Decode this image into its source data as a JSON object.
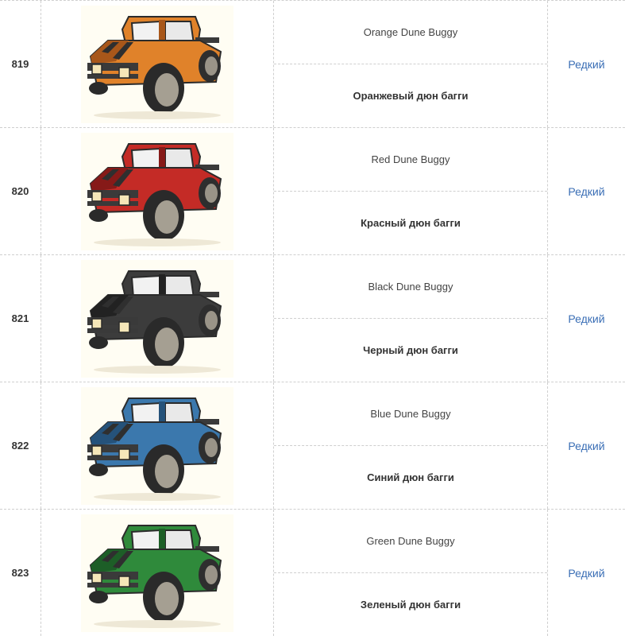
{
  "rows": [
    {
      "id": "819",
      "name_en": "Orange Dune Buggy",
      "name_ru": "Оранжевый дюн багги",
      "rarity": "Редкий",
      "color": "#e0822a",
      "color_dark": "#a8571a",
      "icon": "orange-dune-buggy-icon"
    },
    {
      "id": "820",
      "name_en": "Red Dune Buggy",
      "name_ru": "Красный дюн багги",
      "rarity": "Редкий",
      "color": "#c42b26",
      "color_dark": "#861a18",
      "icon": "red-dune-buggy-icon"
    },
    {
      "id": "821",
      "name_en": "Black Dune Buggy",
      "name_ru": "Черный дюн багги",
      "rarity": "Редкий",
      "color": "#3c3c3c",
      "color_dark": "#222222",
      "icon": "black-dune-buggy-icon"
    },
    {
      "id": "822",
      "name_en": "Blue Dune Buggy",
      "name_ru": "Синий дюн багги",
      "rarity": "Редкий",
      "color": "#3b78ad",
      "color_dark": "#25527a",
      "icon": "blue-dune-buggy-icon"
    },
    {
      "id": "823",
      "name_en": "Green Dune Buggy",
      "name_ru": "Зеленый дюн багги",
      "rarity": "Редкий",
      "color": "#2f8a3b",
      "color_dark": "#1d5e27",
      "icon": "green-dune-buggy-icon"
    }
  ],
  "colors": {
    "rarity_link": "#3a6eb5",
    "divider": "#cfcfcf"
  }
}
